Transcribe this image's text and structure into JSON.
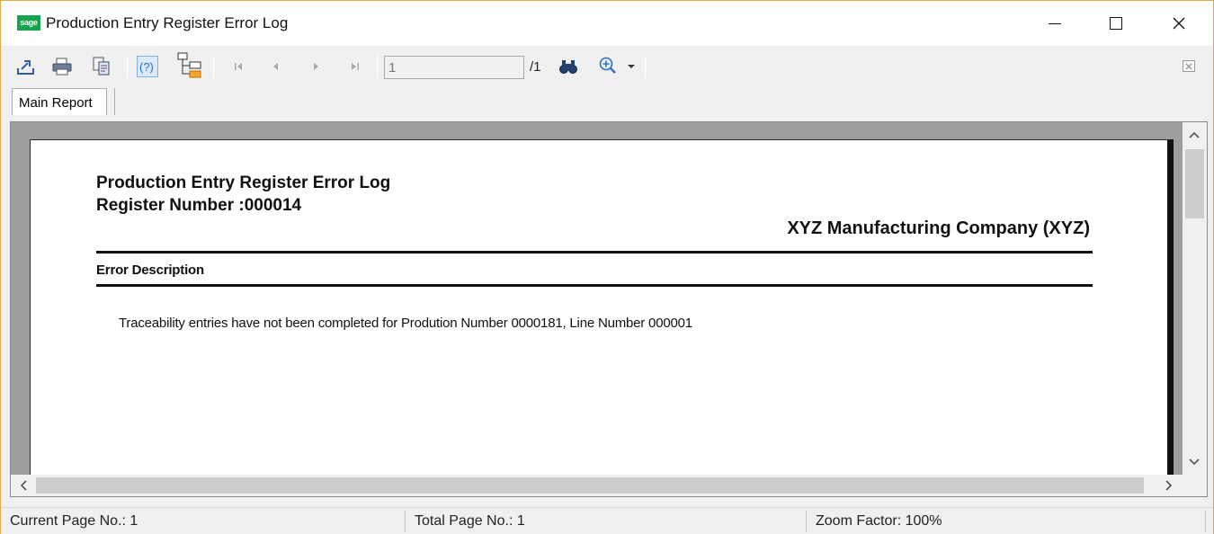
{
  "window": {
    "title": "Production Entry Register Error Log",
    "app_logo_text": "sage",
    "buttons": {
      "minimize": "minimize-icon",
      "maximize": "maximize-icon",
      "close": "close-icon"
    }
  },
  "toolbar": {
    "icons": [
      "export-icon",
      "print-icon",
      "copy-icon",
      "help-icon",
      "group-tree-icon",
      "first-page-icon",
      "previous-page-icon",
      "next-page-icon",
      "last-page-icon",
      "find-icon",
      "zoom-icon"
    ],
    "page_input_value": "1",
    "page_total": "/1",
    "close_report_icon": "close-report-icon"
  },
  "tabs": [
    {
      "label": "Main Report",
      "active": true
    }
  ],
  "report": {
    "title": "Production Entry Register Error Log",
    "register_number": "Register Number :000014",
    "company": "XYZ Manufacturing Company (XYZ)",
    "column_header": "Error Description",
    "lines": [
      "Traceability entries have not been completed for Prodution Number 0000181, Line Number 000001"
    ]
  },
  "statusbar": {
    "current_page": "Current Page No.: 1",
    "total_pages": "Total Page No.: 1",
    "zoom": "Zoom Factor: 100%"
  },
  "colors": {
    "accent_border": "#e4a94a",
    "logo_green": "#14a44d",
    "viewer_bg": "#9e9e9e",
    "help_blue": "#1e6fd9"
  }
}
